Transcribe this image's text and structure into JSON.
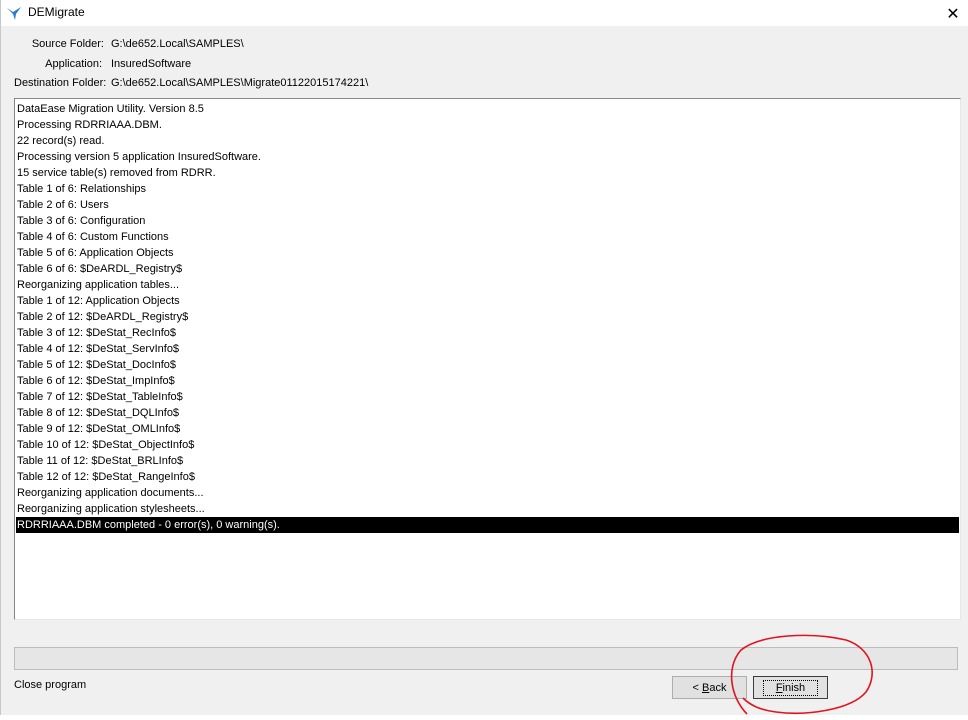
{
  "window": {
    "title": "DEMigrate",
    "close_glyph": "✕"
  },
  "info": {
    "source_folder_label": "Source Folder:",
    "source_folder_value": "G:\\de652.Local\\SAMPLES\\",
    "application_label": "Application:",
    "application_value": "InsuredSoftware",
    "destination_folder_label": "Destination Folder:",
    "destination_folder_value": "G:\\de652.Local\\SAMPLES\\Migrate01122015174221\\"
  },
  "log": {
    "lines": [
      "DataEase Migration Utility. Version 8.5",
      "Processing RDRRIAAA.DBM.",
      "22 record(s) read.",
      "Processing version 5 application InsuredSoftware.",
      "15 service table(s) removed from RDRR.",
      "Table 1 of 6: Relationships",
      "Table 2 of 6: Users",
      "Table 3 of 6: Configuration",
      "Table 4 of 6: Custom Functions",
      "Table 5 of 6: Application Objects",
      "Table 6 of 6: $DeARDL_Registry$",
      "Reorganizing application tables...",
      "Table 1 of 12: Application Objects",
      "Table 2 of 12: $DeARDL_Registry$",
      "Table 3 of 12: $DeStat_RecInfo$",
      "Table 4 of 12: $DeStat_ServInfo$",
      "Table 5 of 12: $DeStat_DocInfo$",
      "Table 6 of 12: $DeStat_ImpInfo$",
      "Table 7 of 12: $DeStat_TableInfo$",
      "Table 8 of 12: $DeStat_DQLInfo$",
      "Table 9 of 12: $DeStat_OMLInfo$",
      "Table 10 of 12: $DeStat_ObjectInfo$",
      "Table 11 of 12: $DeStat_BRLInfo$",
      "Table 12 of 12: $DeStat_RangeInfo$",
      "Reorganizing application documents...",
      "Reorganizing application stylesheets...",
      "RDRRIAAA.DBM completed - 0 error(s), 0 warning(s)."
    ],
    "selected_index": 26
  },
  "progress": {
    "value_percent": 0
  },
  "status": {
    "text": "Close program"
  },
  "buttons": {
    "back_label": "< Back",
    "finish_label": "Finish"
  },
  "colors": {
    "annotation_circle": "#e0141e",
    "selection_bg": "#000000",
    "app_icon": "#2b7bd6"
  }
}
